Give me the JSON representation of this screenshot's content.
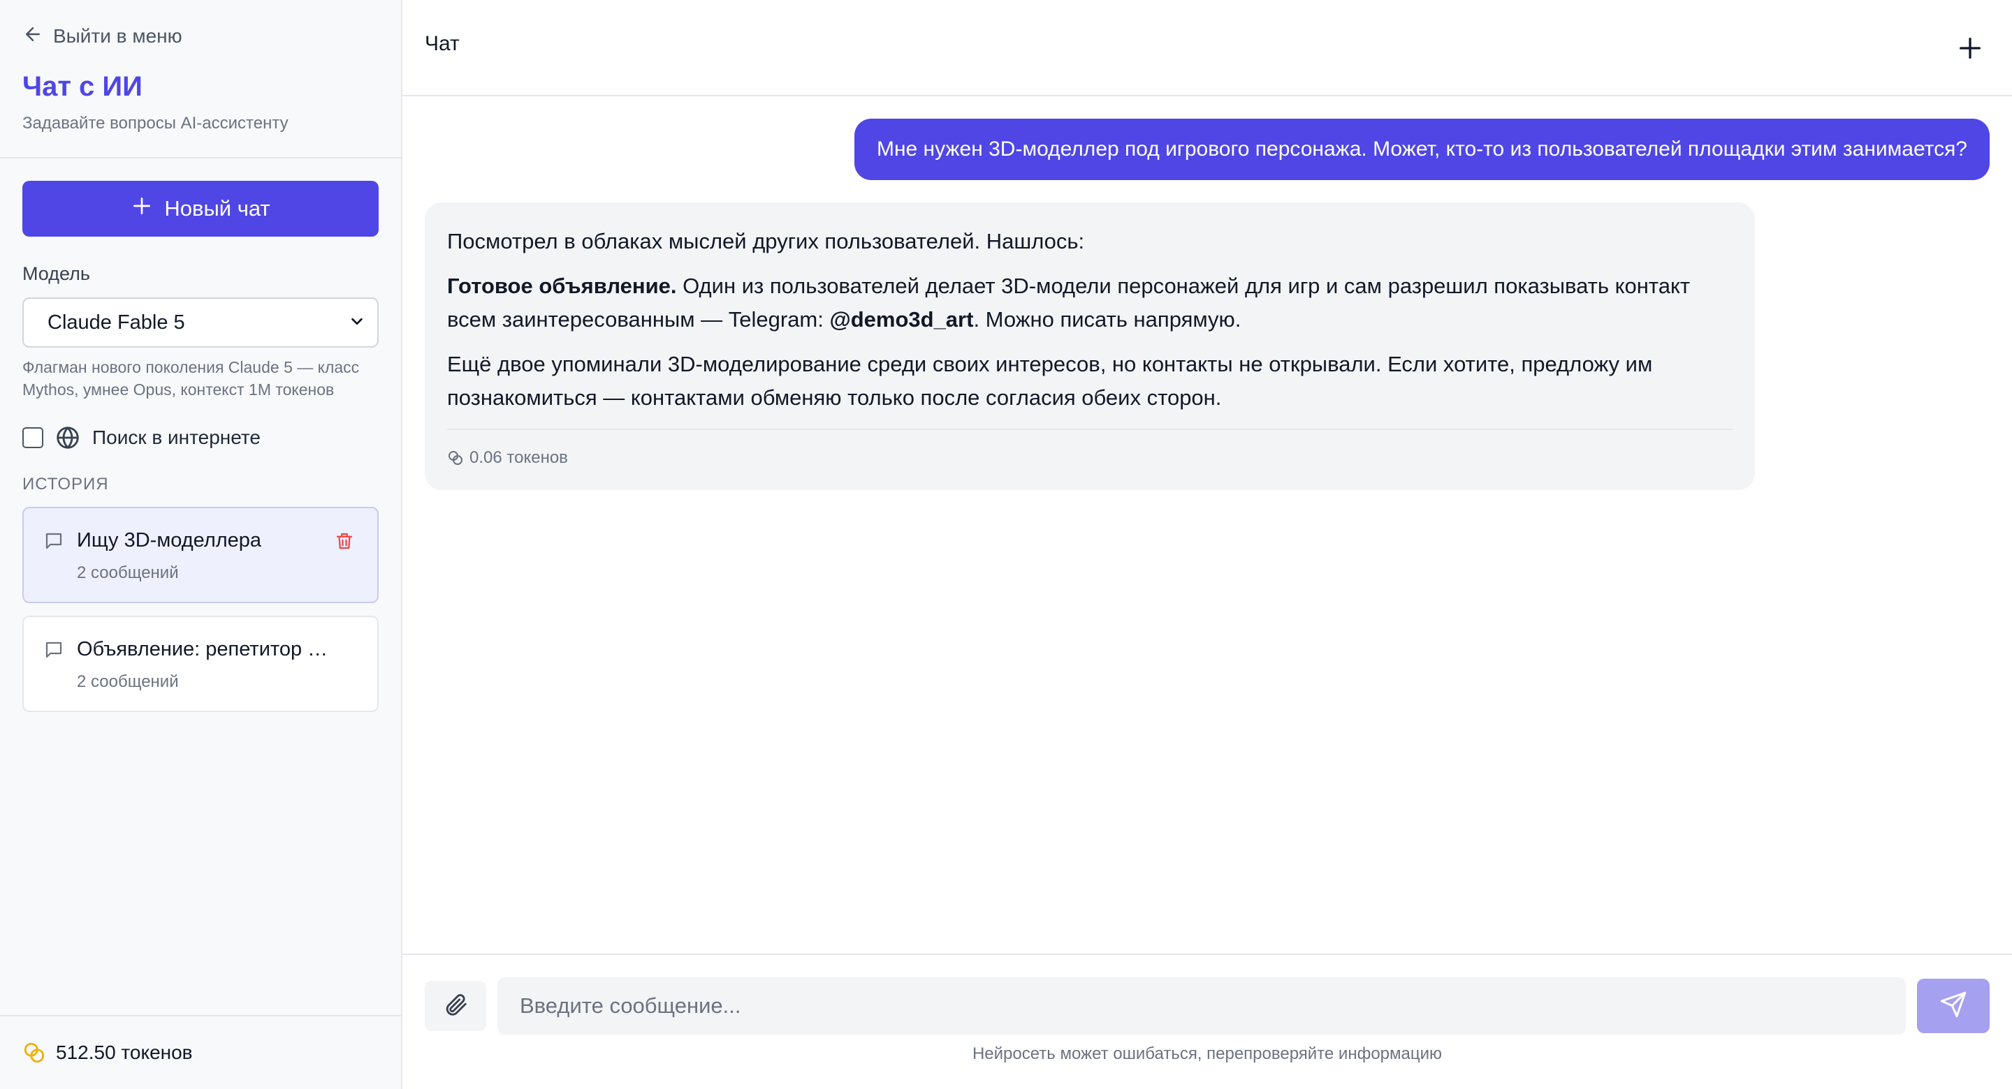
{
  "sidebar": {
    "back_label": "Выйти в меню",
    "title": "Чат с ИИ",
    "subtitle": "Задавайте вопросы AI-ассистенту",
    "new_chat_label": "Новый чат",
    "model_label": "Модель",
    "model_selected": "Claude Fable 5",
    "model_description": "Флагман нового поколения Claude 5 — класс Mythos, умнее Opus, контекст 1М токенов",
    "web_search_label": "Поиск в интернете",
    "web_search_checked": false,
    "history_label": "ИСТОРИЯ",
    "history": [
      {
        "title": "Ищу 3D-моделлера",
        "count": "2 сообщений",
        "active": true
      },
      {
        "title": "Объявление: репетитор …",
        "count": "2 сообщений",
        "active": false
      }
    ],
    "balance": "512.50 токенов"
  },
  "header": {
    "title": "Чат"
  },
  "messages": {
    "user": "Мне нужен 3D-моделлер под игрового персонажа. Может, кто-то из пользователей площадки этим занимается?",
    "assistant": {
      "intro": "Посмотрел в облаках мыслей других пользователей. Нашлось:",
      "p2_bold": "Готовое объявление.",
      "p2_text": " Один из пользователей делает 3D-модели персонажей для игр и сам разрешил показывать контакт всем заинтересованным — Telegram: ",
      "p2_handle": "@demo3d_art",
      "p2_tail": ". Можно писать напрямую.",
      "p3": "Ещё двое упоминали 3D-моделирование среди своих интересов, но контакты не открывали. Если хотите, предложу им познакомиться — контактами обменяю только после согласия обеих сторон.",
      "tokens": "0.06 токенов"
    }
  },
  "composer": {
    "placeholder": "Введите сообщение...",
    "disclaimer": "Нейросеть может ошибаться, перепроверяйте информацию"
  },
  "colors": {
    "accent": "#4f46e5",
    "send_disabled": "#a5a0f0",
    "danger": "#ef4444",
    "coin": "#eab308"
  }
}
